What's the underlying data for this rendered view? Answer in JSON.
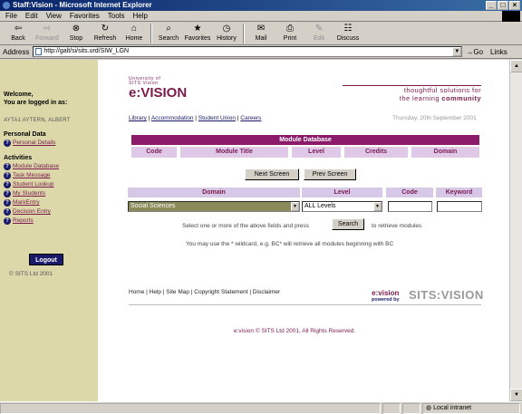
{
  "window": {
    "title": "Staff:Vision - Microsoft Internet Explorer"
  },
  "menu": [
    "File",
    "Edit",
    "View",
    "Favorites",
    "Tools",
    "Help"
  ],
  "toolbar": [
    {
      "label": "Back",
      "icon": "back-arrow-icon",
      "glyph": "⇦",
      "enabled": true
    },
    {
      "label": "Forward",
      "icon": "forward-arrow-icon",
      "glyph": "⇨",
      "enabled": false
    },
    {
      "label": "Stop",
      "icon": "stop-icon",
      "glyph": "⊗",
      "enabled": true
    },
    {
      "label": "Refresh",
      "icon": "refresh-icon",
      "glyph": "↻",
      "enabled": true
    },
    {
      "label": "Home",
      "icon": "home-icon",
      "glyph": "⌂",
      "enabled": true
    },
    {
      "label": "Search",
      "icon": "search-icon",
      "glyph": "⌕",
      "enabled": true
    },
    {
      "label": "Favorites",
      "icon": "favorites-icon",
      "glyph": "★",
      "enabled": true
    },
    {
      "label": "History",
      "icon": "history-icon",
      "glyph": "◷",
      "enabled": true
    },
    {
      "label": "Mail",
      "icon": "mail-icon",
      "glyph": "✉",
      "enabled": true
    },
    {
      "label": "Print",
      "icon": "print-icon",
      "glyph": "⎙",
      "enabled": true
    },
    {
      "label": "Edit",
      "icon": "edit-icon",
      "glyph": "✎",
      "enabled": false
    },
    {
      "label": "Discuss",
      "icon": "discuss-icon",
      "glyph": "☷",
      "enabled": true
    }
  ],
  "address": {
    "label": "Address",
    "url": "http://galt/si/sits.urd/SIW_LGN",
    "go": "Go",
    "links": "Links"
  },
  "sidebar": {
    "welcome": "Welcome,",
    "logged": "You are logged in as:",
    "username": "AYTA1 AYTERN, ALBERT",
    "personal_head": "Personal Data",
    "personal_items": [
      "Personal Details"
    ],
    "activities_head": "Activities",
    "activities": [
      "Module Database",
      "Task Message",
      "Student Lookup",
      "My Students",
      "MarkEntry",
      "Decision Entry",
      "Reports"
    ],
    "logout": "Logout",
    "copyright": "© SITS Ltd 2001"
  },
  "header": {
    "logo_small1": "University of",
    "logo_small2": "SITS Vision",
    "logo_big": "e:VISION",
    "tagline1": "thoughtful solutions for",
    "tagline2a": "the learning ",
    "tagline2b": "community",
    "links": [
      "Library",
      "Accommodation",
      "Student Union",
      "Careers"
    ],
    "date": "Thursday, 20th September 2001"
  },
  "module_db": {
    "title": "Module Database",
    "columns": [
      "Code",
      "Module Title",
      "Level",
      "Credits",
      "Domain"
    ],
    "next": "Next Screen",
    "prev": "Prev Screen"
  },
  "search": {
    "headers": [
      "Domain",
      "Level",
      "Code",
      "Keyword"
    ],
    "domain_value": "Social Sciences",
    "level_value": "ALL Levels",
    "code_value": "",
    "keyword_value": "",
    "hint_before": "Select one or more of the above fields and press",
    "button": "Search",
    "hint_after": "to retrieve modules",
    "wildcard": "You may use the * wildcard, e.g. BC* will retrieve all modules beginning with BC"
  },
  "footer": {
    "links": "Home | Help | Site Map | Copyright Statement | Disclaimer",
    "evision": "e:vision",
    "powered": "powered by",
    "sits": "SITS:VISION",
    "copyright": "e:vision © SITS Ltd 2001, All Rights Reserved."
  },
  "status": {
    "zone": "Local intranet"
  },
  "colors": {
    "accent": "#7b1a4e",
    "header_bar": "#8b1a6b",
    "sidebar": "#dcd8aa"
  }
}
